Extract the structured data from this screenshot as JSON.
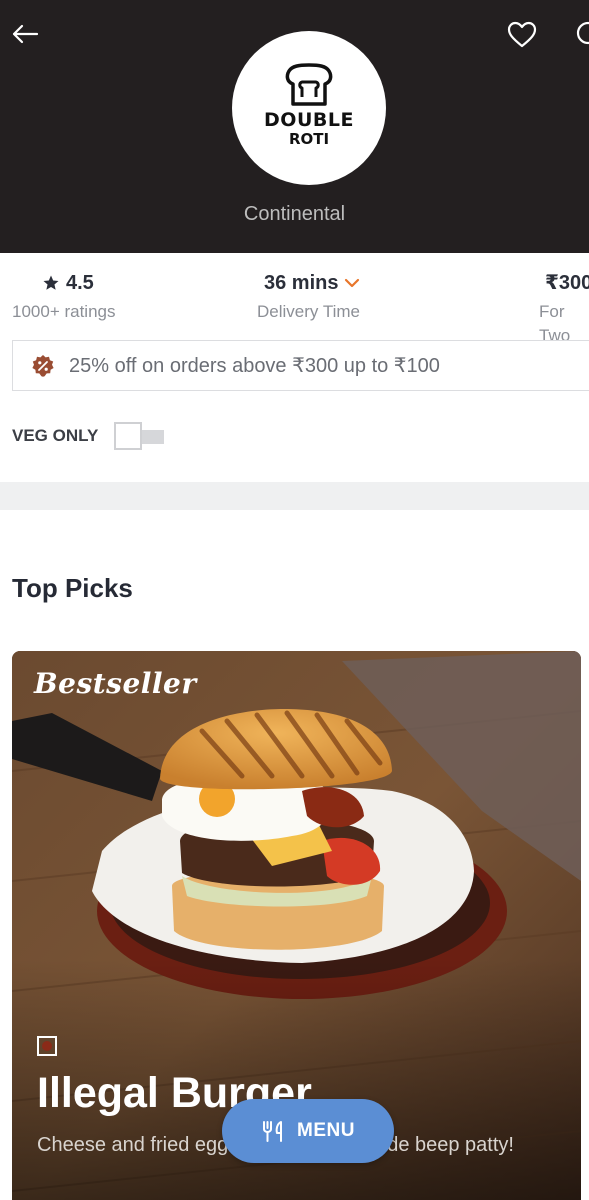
{
  "restaurant": {
    "logo_line1": "DOUBLE",
    "logo_line2": "ROTI",
    "cuisine": "Continental"
  },
  "stats": {
    "rating": {
      "value": "4.5",
      "label": "1000+ ratings"
    },
    "delivery": {
      "value": "36 mins",
      "label": "Delivery Time"
    },
    "cost": {
      "value": "₹300",
      "label": "For Two"
    }
  },
  "offer": {
    "text": "25% off on orders above ₹300 up to ₹100"
  },
  "veg_filter": {
    "label": "VEG ONLY",
    "enabled": false
  },
  "section": {
    "title": "Top Picks"
  },
  "top_pick": {
    "badge": "Bestseller",
    "name": "Illegal Burger",
    "description": "Cheese and fried egg with our homemade beep patty!",
    "type": "non-veg"
  },
  "menu_button": {
    "label": "MENU"
  },
  "colors": {
    "header_bg": "#231f20",
    "accent_orange": "#e8762b",
    "menu_button": "#5b8ed4",
    "offer_icon": "#9a4d33",
    "nonveg": "#8b2a18"
  },
  "icons": {
    "back": "arrow-left-icon",
    "favorite": "heart-icon",
    "search": "search-icon",
    "rating": "star-icon",
    "delivery_toggle": "chevron-down-icon",
    "offer": "discount-badge-icon",
    "menu": "cutlery-icon"
  }
}
